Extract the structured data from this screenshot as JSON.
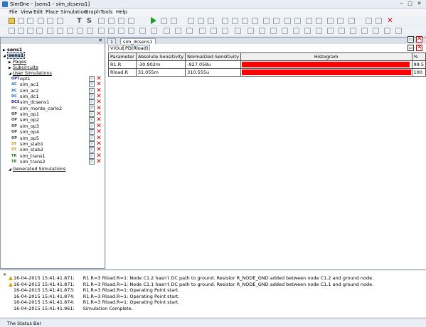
{
  "window": {
    "title": "SimOne - [sens1 - sim_dcsens1]",
    "controls": [
      "−",
      "□",
      "✕"
    ]
  },
  "menu": [
    "File",
    "View",
    "Edit",
    "Place",
    "Simulation",
    "Graph",
    "Tools",
    "Help"
  ],
  "tree": {
    "root_label": "sens1",
    "project_label": "sens1",
    "pages_label": "Pages",
    "subcircuits_label": "Subcircuits",
    "user_sims_label": "User Simulations",
    "generated_label": "Generated Simulations",
    "simulations": [
      {
        "tag": "OPT",
        "name": "opt1",
        "tag_color": "#1a1a8a"
      },
      {
        "tag": "AC",
        "name": "sim_ac1",
        "tag_color": "#1a6ac8"
      },
      {
        "tag": "AC",
        "name": "sim_ac2",
        "tag_color": "#1a6ac8"
      },
      {
        "tag": "DC",
        "name": "sim_dc1",
        "tag_color": "#1a6ac8"
      },
      {
        "tag": "DCS",
        "name": "sim_dcsens1",
        "tag_color": "#1a1a8a"
      },
      {
        "tag": "MC",
        "name": "sim_monte_carlo2",
        "tag_color": "#7a7a7a"
      },
      {
        "tag": "OP",
        "name": "sim_op1",
        "tag_color": "#3a3a3a"
      },
      {
        "tag": "OP",
        "name": "sim_op2",
        "tag_color": "#3a3a3a"
      },
      {
        "tag": "OP",
        "name": "sim_op3",
        "tag_color": "#3a3a3a"
      },
      {
        "tag": "OP",
        "name": "sim_op4",
        "tag_color": "#3a3a3a"
      },
      {
        "tag": "OP",
        "name": "sim_op5",
        "tag_color": "#3a3a3a"
      },
      {
        "tag": "ST",
        "name": "sim_stab1",
        "tag_color": "#d08a00"
      },
      {
        "tag": "ST",
        "name": "sim_stab2",
        "tag_color": "#d08a00"
      },
      {
        "tag": "TR",
        "name": "sim_trans1",
        "tag_color": "#1a7a1a"
      },
      {
        "tag": "TR",
        "name": "sim_trans2",
        "tag_color": "#1a7a1a"
      }
    ]
  },
  "main": {
    "tabs": [
      "1",
      "sim_dcsens1"
    ],
    "subtabs": [
      "V(Out)",
      "PD(Rload)"
    ],
    "table": {
      "headers": [
        "Parameter",
        "Absolute Sensitivity",
        "Normalized Sensitivity",
        "Histogram",
        "%"
      ],
      "rows": [
        {
          "param": "R1.R",
          "abs": "-30.902m",
          "norm": "-927.058u",
          "pct": "99.5",
          "fraction": 0.995
        },
        {
          "param": "Rload.R",
          "abs": "31.055m",
          "norm": "310.555u",
          "pct": "100",
          "fraction": 1.0
        }
      ]
    }
  },
  "log": [
    {
      "warn": true,
      "time": "16-04-2015 15:41:41.871:",
      "msg": "R1.R=3 Rload.R=1: Node C1.2 hasn't DC path to ground. Resistor R_NODE_GND added between node C1.2 and ground node."
    },
    {
      "warn": true,
      "time": "16-04-2015 15:41:41.871:",
      "msg": "R1.R=3 Rload.R=1: Node C1.1 hasn't DC path to ground. Resistor R_NODE_GND added between node C1.1 and ground node."
    },
    {
      "warn": false,
      "time": "16-04-2015 15:41:41.873:",
      "msg": "R1.R=3 Rload.R=1: Operating Point start."
    },
    {
      "warn": false,
      "time": "16-04-2015 15:41:41.874:",
      "msg": "R1.R=3 Rload.R=1: Operating Point start."
    },
    {
      "warn": false,
      "time": "16-04-2015 15:41:41.874:",
      "msg": "R1.R=3 Rload.R=1: Operating Point start."
    },
    {
      "warn": false,
      "time": "16-04-2015 15:41:41.961:",
      "msg": "Simulation Complete."
    }
  ],
  "status": {
    "text": "The Status Bar"
  },
  "colors": {
    "histogram_bar": "#ff0000",
    "accent": "#2f73c8"
  },
  "icons": {
    "toolbar1": [
      "open-folder-icon",
      "pdf-icon",
      "save-icon",
      "cut-icon",
      "copy-icon",
      "paste-icon",
      "text-icon",
      "spice-icon",
      "run-icon",
      "pause-icon",
      "stop-icon",
      "close-icon"
    ],
    "toolbar2": [
      "wire-icon",
      "component-icon",
      "zoom-icon"
    ]
  }
}
